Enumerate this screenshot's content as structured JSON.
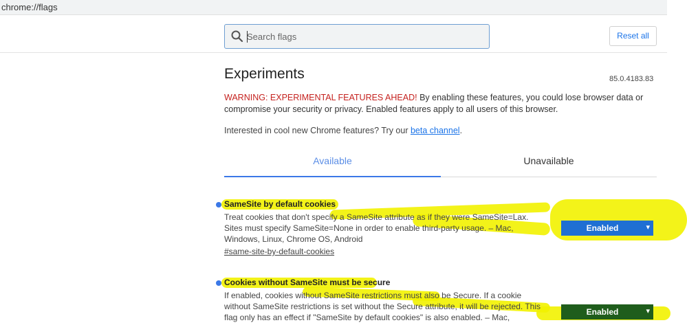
{
  "address_bar": {
    "url": "chrome://flags"
  },
  "search": {
    "placeholder": "Search flags",
    "value": ""
  },
  "reset_all_label": "Reset all",
  "page_title": "Experiments",
  "version": "85.0.4183.83",
  "warning": {
    "red_text": "WARNING: EXPERIMENTAL FEATURES AHEAD!",
    "rest_text": " By enabling these features, you could lose browser data or compromise your security or privacy. Enabled features apply to all users of this browser."
  },
  "interest": {
    "prefix": "Interested in cool new Chrome features? Try our ",
    "link": "beta channel",
    "suffix": "."
  },
  "tabs": [
    {
      "label": "Available",
      "active": true
    },
    {
      "label": "Unavailable",
      "active": false
    }
  ],
  "flags": [
    {
      "title": "SameSite by default cookies",
      "description": "Treat cookies that don't specify a SameSite attribute as if they were SameSite=Lax. Sites must specify SameSite=None in order to enable third-party usage. – Mac, Windows, Linux, Chrome OS, Android",
      "link": "#same-site-by-default-cookies",
      "state": "Enabled"
    },
    {
      "title": "Cookies without SameSite must be secure",
      "description": "If enabled, cookies without SameSite restrictions must also be Secure. If a cookie without SameSite restrictions is set without the Secure attribute, it will be rejected. This flag only has an effect if \"SameSite by default cookies\" is also enabled. – Mac, Windows, Linux, Chrome",
      "link": "",
      "state": "Enabled"
    }
  ],
  "colors": {
    "accent_blue": "#1a73e8",
    "warning_red": "#c5221f",
    "highlight_yellow": "#f2f200",
    "select_blue": "#1f6fd3",
    "select_green_overlay": "#1f5d1c"
  },
  "icons": {
    "search": "search-icon",
    "dropdown": "chevron-down-icon",
    "flag_status": "flag-dot-icon"
  }
}
